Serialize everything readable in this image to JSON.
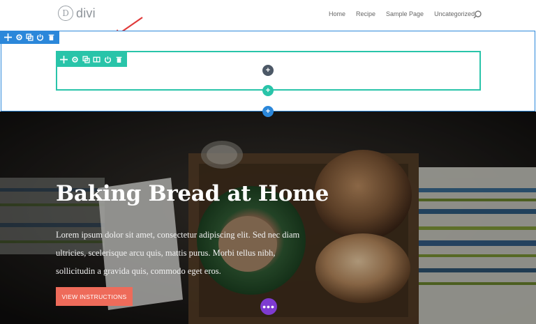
{
  "header": {
    "logo_letter": "D",
    "logo_text": "divi",
    "nav": [
      "Home",
      "Recipe",
      "Sample Page",
      "Uncategorized"
    ]
  },
  "builder": {
    "section_toolbar_icons": [
      "move-icon",
      "gear-icon",
      "duplicate-icon",
      "power-icon",
      "trash-icon"
    ],
    "row_toolbar_icons": [
      "move-icon",
      "gear-icon",
      "duplicate-icon",
      "columns-icon",
      "power-icon",
      "trash-icon"
    ],
    "add_module": "+",
    "add_row": "+",
    "add_section": "+",
    "colors": {
      "section": "#2b87da",
      "row": "#29c4a9",
      "module": "#4c5866",
      "more": "#7e3bd0"
    }
  },
  "hero": {
    "title": "Baking Bread at Home",
    "body": "Lorem ipsum dolor sit amet, consectetur adipiscing elit. Sed nec diam ultricies, scelerisque arcu quis, mattis purus. Morbi tellus nibh, sollicitudin a gravida quis, commodo eget eros.",
    "cta_label": "VIEW INSTRUCTIONS",
    "cta_color": "#ee6b5a",
    "more_label": "•••"
  }
}
